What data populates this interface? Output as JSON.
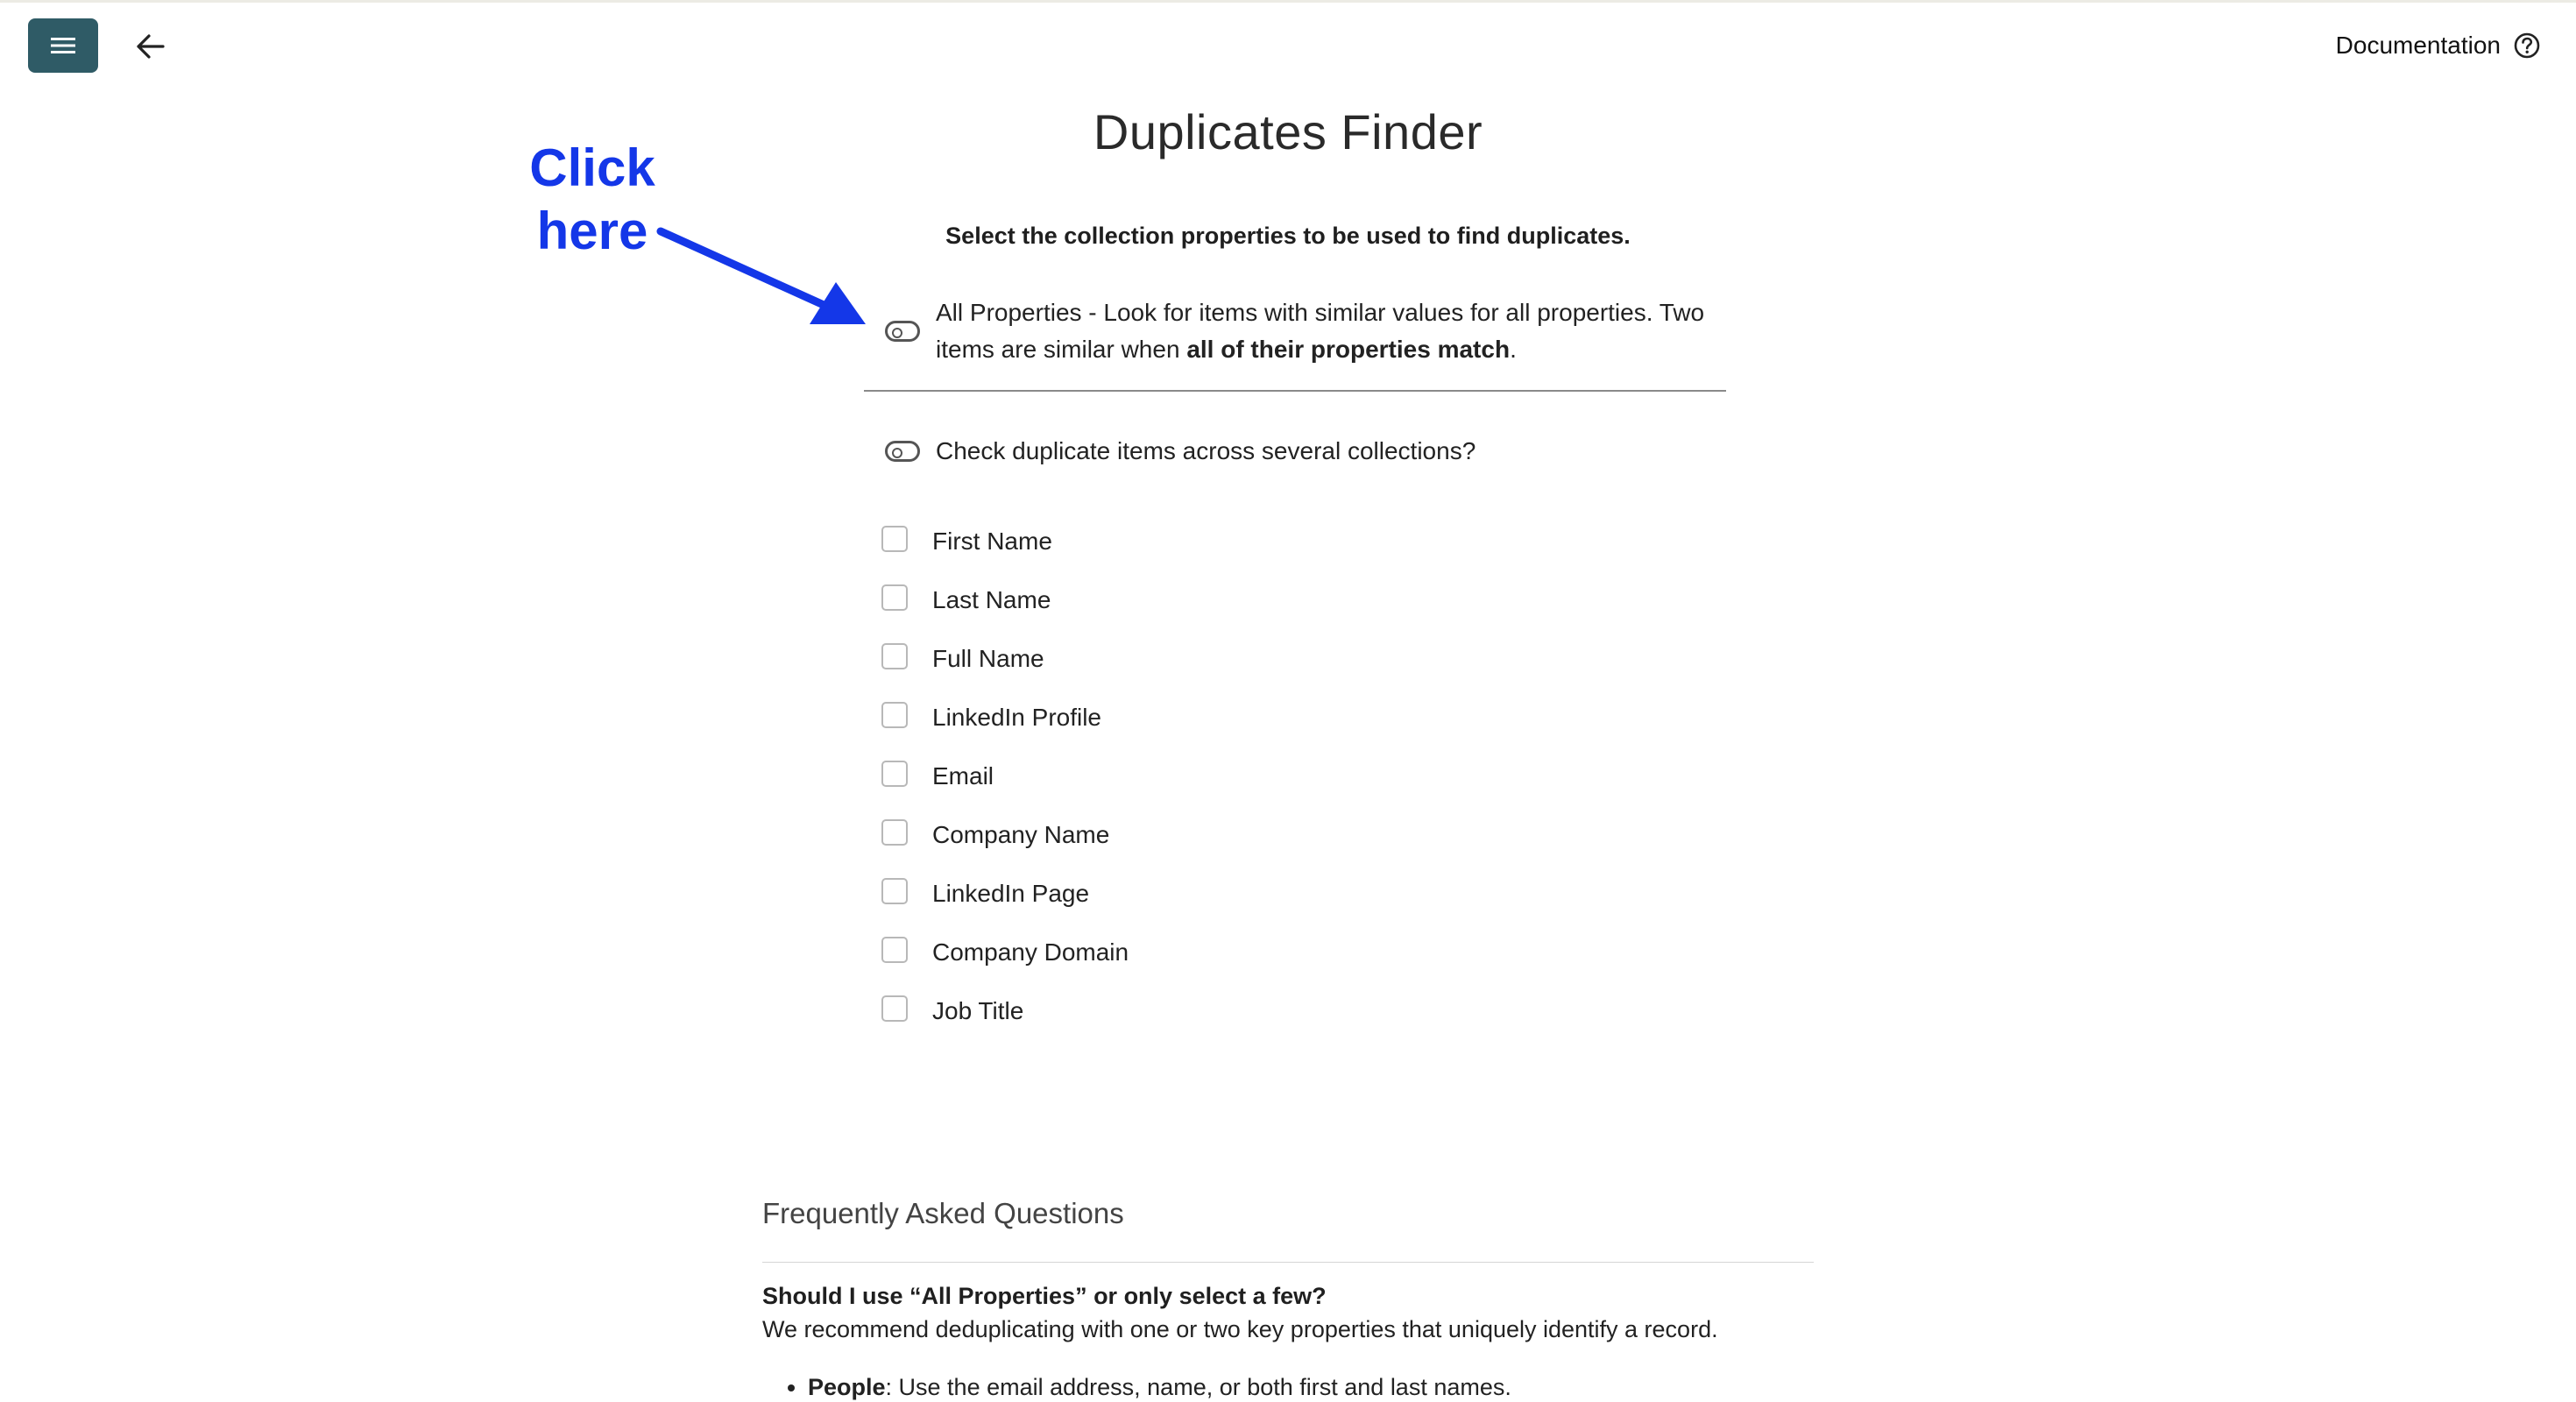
{
  "header": {
    "menu_icon": "hamburger-menu-icon",
    "back_icon": "arrow-left-icon",
    "documentation_label": "Documentation",
    "help_icon": "question-circle-icon",
    "accent_color": "#2f5b66"
  },
  "annotation": {
    "line1": "Click",
    "line2": "here",
    "color": "#1437e8"
  },
  "main": {
    "title": "Duplicates Finder",
    "subtitle": "Select the collection properties to be used to find duplicates.",
    "all_properties_toggle": {
      "text_before": "All Properties - Look for items with similar values for all properties. Two items are similar when ",
      "text_bold": "all of their properties match",
      "text_after": ".",
      "checked": false
    },
    "cross_collection_toggle": {
      "label": "Check duplicate items across several collections?",
      "checked": false
    },
    "properties": [
      {
        "label": "First Name",
        "checked": false
      },
      {
        "label": "Last Name",
        "checked": false
      },
      {
        "label": "Full Name",
        "checked": false
      },
      {
        "label": "LinkedIn Profile",
        "checked": false
      },
      {
        "label": "Email",
        "checked": false
      },
      {
        "label": "Company Name",
        "checked": false
      },
      {
        "label": "LinkedIn Page",
        "checked": false
      },
      {
        "label": "Company Domain",
        "checked": false
      },
      {
        "label": "Job Title",
        "checked": false
      }
    ]
  },
  "faq": {
    "title": "Frequently Asked Questions",
    "question": "Should I use “All Properties” or only select a few?",
    "answer": "We recommend deduplicating with one or two key properties that uniquely identify a record.",
    "bullets": [
      {
        "bold": "People",
        "text": ": Use the email address, name, or both first and last names."
      }
    ]
  }
}
